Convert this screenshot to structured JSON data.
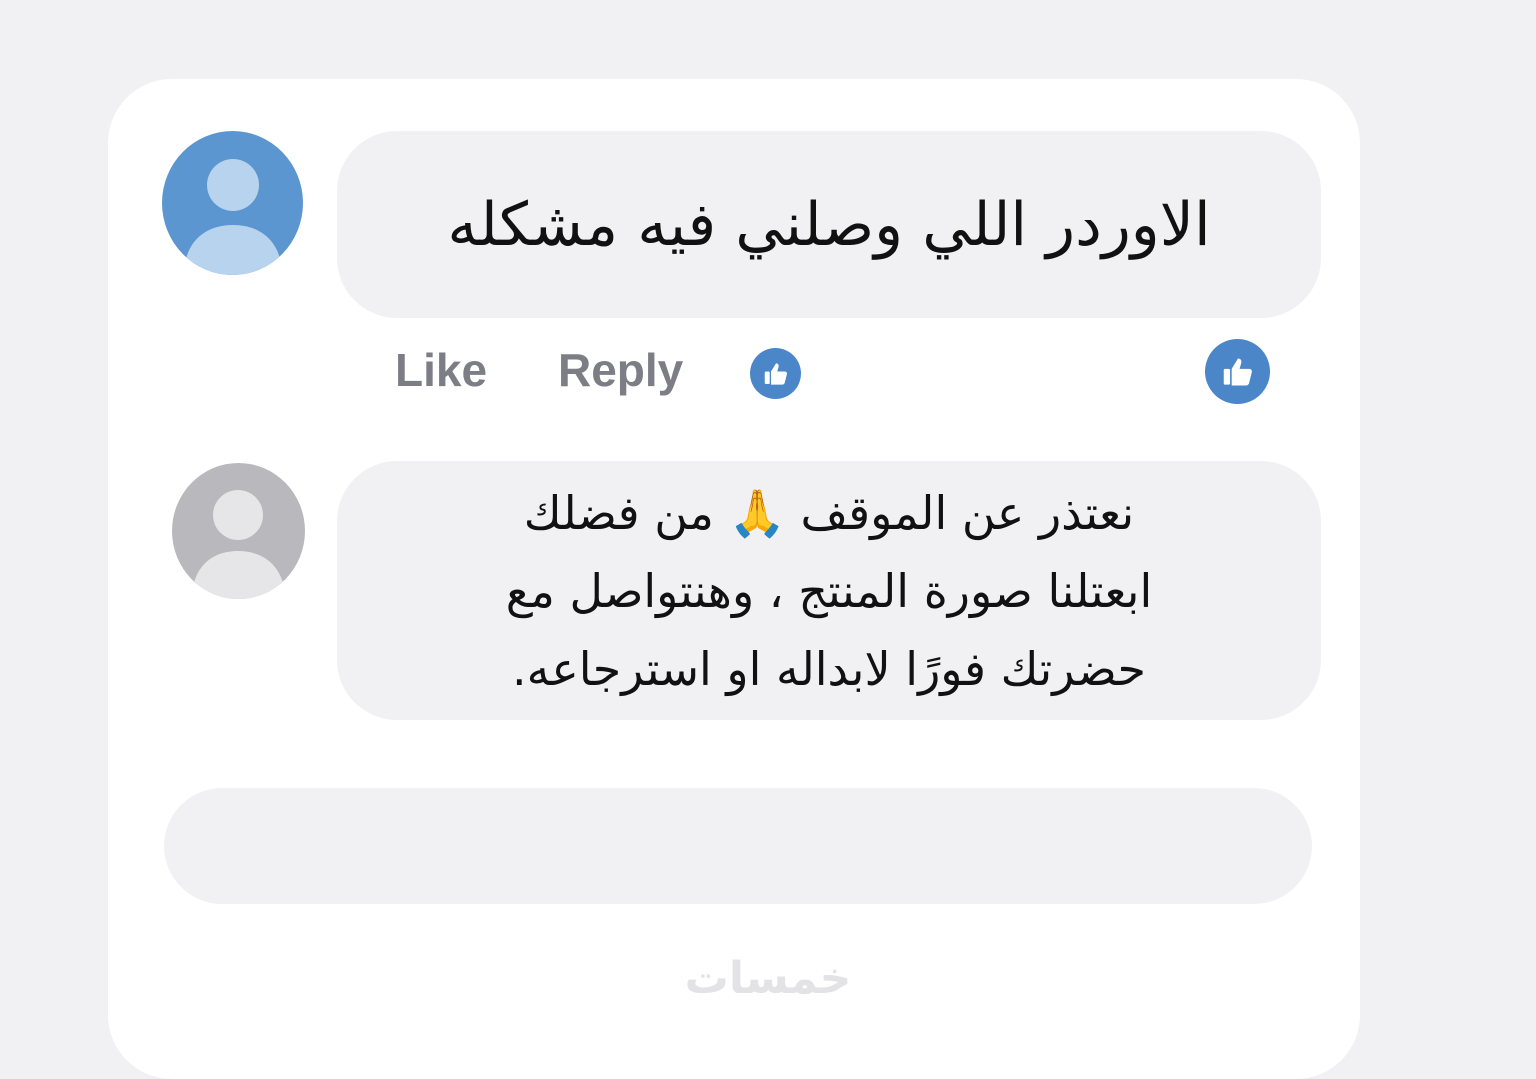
{
  "comment": {
    "text": "الاوردر اللي وصلني فيه مشكله",
    "avatar_icon": "default-user-avatar-icon",
    "avatar_color": "#5b96d0",
    "avatar_figure_color": "#b7d3ee"
  },
  "actions": {
    "like_label": "Like",
    "reply_label": "Reply",
    "reaction_icon": "thumbs-up-icon",
    "reaction_color": "#4a86c8"
  },
  "reply": {
    "lines": [
      "نعتذر عن الموقف 🙏 من فضلك",
      "ابعتلنا صورة المنتج ، وهنتواصل مع",
      "حضرتك فورًا لابداله او استرجاعه."
    ],
    "avatar_icon": "default-user-avatar-icon",
    "avatar_color": "#b9b9bd",
    "avatar_figure_color": "#e6e6e8"
  },
  "composer": {
    "value": "",
    "placeholder": ""
  },
  "watermark": {
    "text": "خمسات"
  }
}
